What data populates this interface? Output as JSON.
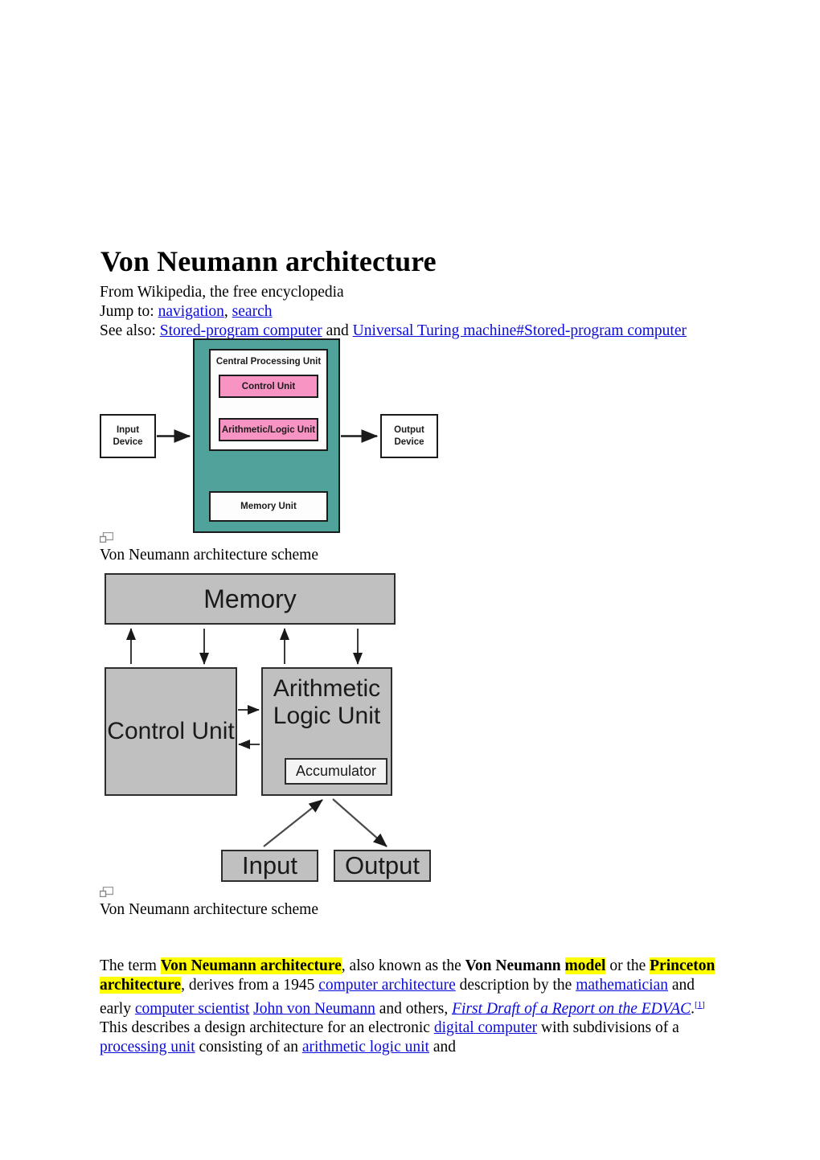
{
  "page": {
    "title": "Von Neumann architecture",
    "from_line": "From Wikipedia, the free encyclopedia",
    "jump_prefix": "Jump to: ",
    "jump_links": [
      {
        "label": "navigation"
      },
      {
        "label": "search"
      }
    ],
    "jump_separator": ", ",
    "seealso_prefix": "See also: ",
    "seealso_links": [
      {
        "label": "Stored-program computer"
      },
      {
        "label": "Universal Turing machine#Stored-program computer"
      }
    ],
    "seealso_conjunction": " and "
  },
  "figure_1": {
    "caption": "Von Neumann architecture scheme",
    "enlarge_icon": "enlarge-icon",
    "colors": {
      "container": "#50a39b",
      "unit_fill": "#f794c3",
      "box_fill": "#fdfdfd",
      "stroke": "#1b1b1b"
    },
    "cpu_label": "Central Processing Unit",
    "control_unit": "Control Unit",
    "alu": "Arithmetic/Logic Unit",
    "memory_unit": "Memory Unit",
    "input_device": "Input Device",
    "output_device": "Output Device"
  },
  "figure_2": {
    "caption": "Von Neumann architecture scheme",
    "enlarge_icon": "enlarge-icon",
    "colors": {
      "box_fill": "#c0c0c0",
      "accumulator_fill": "#f4f4f4",
      "stroke": "#2d2d2d"
    },
    "memory": "Memory",
    "control_unit": "Control Unit",
    "alu": "Arithmetic Logic Unit",
    "accumulator": "Accumulator",
    "input": "Input",
    "output": "Output"
  },
  "body": {
    "s1": "The term ",
    "hl1": "Von Neumann architecture",
    "s2": ", also known as the ",
    "b1": "Von Neumann ",
    "hl2": "model",
    "s3": " or the ",
    "hl3": "Princeton architecture",
    "s4": ", derives from a 1945 ",
    "l1": "computer architecture",
    "s5": " description by the ",
    "l2": "mathematician",
    "s6": " and early ",
    "l3": "computer scientist",
    "s7": " ",
    "l4": "John von Neumann",
    "s8": " and others, ",
    "l5": "First Draft of a Report on the EDVAC",
    "s9": ".",
    "ref1": "[1]",
    "s10": " This describes a design architecture for an electronic ",
    "l6": "digital computer",
    "s11": " with subdivisions of a ",
    "l7": "processing unit",
    "s12": " consisting of an ",
    "l8": "arithmetic logic unit",
    "s13": " and"
  },
  "colors": {
    "link": "#0b0bdb",
    "highlight": "#ffff00",
    "text": "#000000",
    "background": "#ffffff"
  }
}
